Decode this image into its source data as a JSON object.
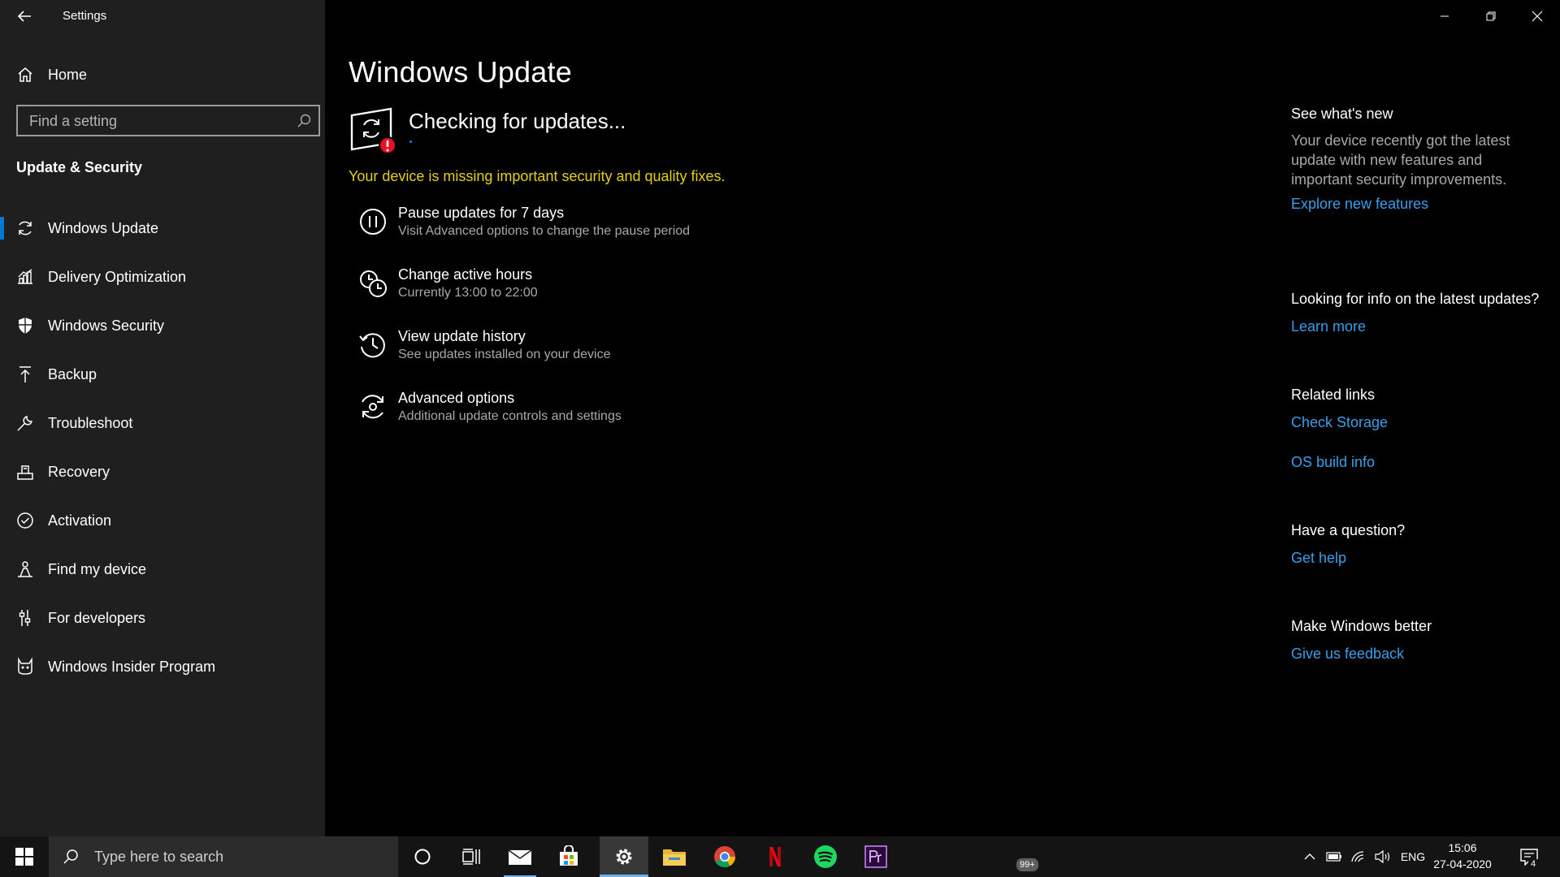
{
  "window": {
    "app_title": "Settings",
    "minimize_icon": "minimize-icon",
    "restore_icon": "restore-icon",
    "close_icon": "close-icon"
  },
  "sidebar": {
    "home_label": "Home",
    "search_placeholder": "Find a setting",
    "section_title": "Update & Security",
    "items": [
      {
        "label": "Windows Update",
        "icon": "sync-icon",
        "active": true
      },
      {
        "label": "Delivery Optimization",
        "icon": "delivery-optimization-icon"
      },
      {
        "label": "Windows Security",
        "icon": "shield-icon"
      },
      {
        "label": "Backup",
        "icon": "backup-arrow-icon"
      },
      {
        "label": "Troubleshoot",
        "icon": "wrench-icon"
      },
      {
        "label": "Recovery",
        "icon": "recovery-icon"
      },
      {
        "label": "Activation",
        "icon": "check-circle-icon"
      },
      {
        "label": "Find my device",
        "icon": "person-pin-icon"
      },
      {
        "label": "For developers",
        "icon": "developer-sliders-icon"
      },
      {
        "label": "Windows Insider Program",
        "icon": "insider-cat-icon"
      }
    ],
    "accent_color": "#0078d7"
  },
  "main": {
    "title": "Windows Update",
    "status": "Checking for updates...",
    "warning": "Your device is missing important security and quality fixes.",
    "warning_color": "#e5cf14",
    "options": [
      {
        "title": "Pause updates for 7 days",
        "subtitle": "Visit Advanced options to change the pause period",
        "icon": "pause-icon"
      },
      {
        "title": "Change active hours",
        "subtitle": "Currently 13:00 to 22:00",
        "icon": "active-hours-clock-icon"
      },
      {
        "title": "View update history",
        "subtitle": "See updates installed on your device",
        "icon": "history-icon"
      },
      {
        "title": "Advanced options",
        "subtitle": "Additional update controls and settings",
        "icon": "advanced-sync-gear-icon"
      }
    ]
  },
  "right": {
    "whats_new_heading": "See what's new",
    "whats_new_text": "Your device recently got the latest update with new features and important security improvements.",
    "whats_new_link": "Explore new features",
    "latest_heading": "Looking for info on the latest updates?",
    "latest_link": "Learn more",
    "related_heading": "Related links",
    "related_links": [
      "Check Storage",
      "OS build info"
    ],
    "question_heading": "Have a question?",
    "question_link": "Get help",
    "better_heading": "Make Windows better",
    "better_link": "Give us feedback",
    "link_color": "#3a9ee8"
  },
  "taskbar": {
    "search_placeholder": "Type here to search",
    "mail_badge": "99+",
    "language": "ENG",
    "time": "15:06",
    "date": "27-04-2020",
    "notification_count": "4",
    "apps": [
      "cortana-icon",
      "task-view-icon",
      "mail-icon",
      "store-icon",
      "settings-gear-icon",
      "file-explorer-icon",
      "chrome-icon",
      "netflix-icon",
      "spotify-icon",
      "premiere-pro-icon"
    ]
  }
}
